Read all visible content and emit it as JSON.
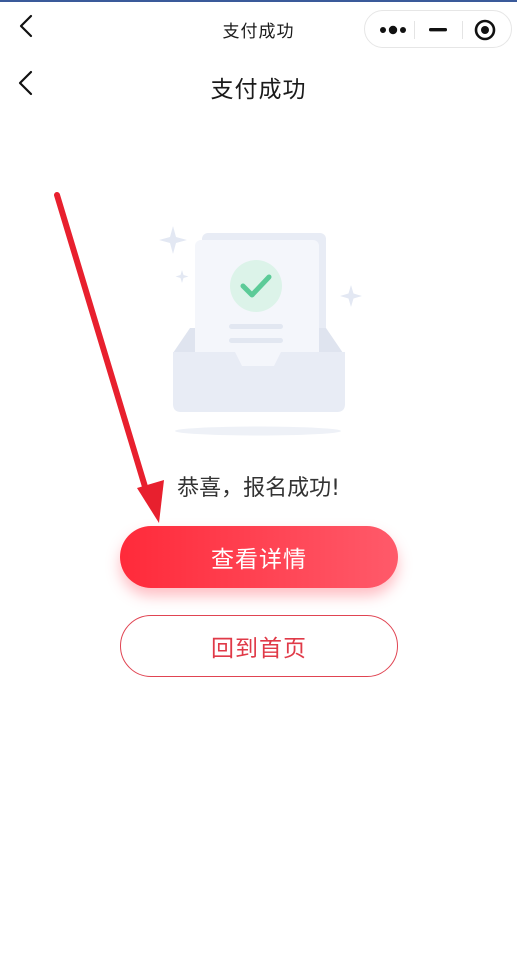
{
  "mp_bar": {
    "title": "支付成功",
    "icons": {
      "back": "chevron-left-icon",
      "more": "more-dots-icon",
      "minimize": "minimize-icon",
      "close": "target-close-icon"
    }
  },
  "header": {
    "title": "支付成功",
    "back_icon": "chevron-left-icon"
  },
  "illustration": {
    "icon": "document-inbox-check-icon",
    "colors": {
      "check_circle": "#d9f3e8",
      "check_mark": "#5fcf9e",
      "tray": "#e7ebf4",
      "paper": "#f5f7fc"
    }
  },
  "result": {
    "message": "恭喜，报名成功!"
  },
  "actions": {
    "primary_label": "查看详情",
    "secondary_label": "回到首页"
  },
  "annotation": {
    "type": "red-arrow",
    "color": "#e8202e",
    "points_to": "view-details-button"
  },
  "colors": {
    "brand_red": "#ff2a3a",
    "brand_red_light": "#ff5a6a",
    "outline_red": "#e04452"
  }
}
